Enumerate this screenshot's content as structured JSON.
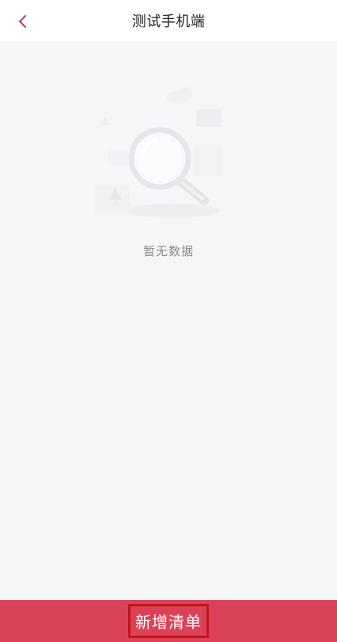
{
  "header": {
    "title": "测试手机端",
    "back_icon": "chevron-left-icon"
  },
  "empty_state": {
    "message": "暂无数据",
    "icon": "magnifier-icon"
  },
  "footer": {
    "button_label": "新增清单"
  },
  "colors": {
    "accent": "#dc4257",
    "background": "#f5f6f8",
    "header_bg": "#ffffff",
    "back_icon": "#c43a4f"
  }
}
